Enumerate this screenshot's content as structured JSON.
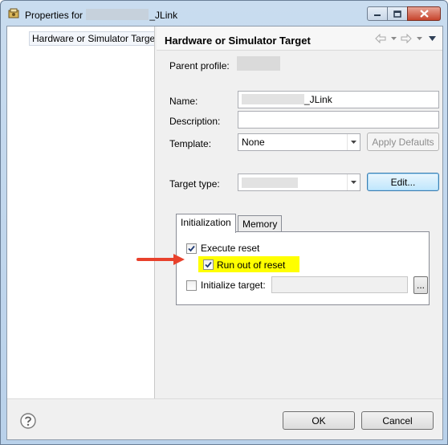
{
  "window": {
    "title_prefix": "Properties for",
    "title_suffix": "_JLink"
  },
  "left_tree": {
    "items": [
      {
        "label": "Hardware or Simulator Target"
      }
    ]
  },
  "page": {
    "title": "Hardware or Simulator Target",
    "parent_profile_label": "Parent profile:",
    "name_label": "Name:",
    "name_value_suffix": "_JLink",
    "description_label": "Description:",
    "description_value": "",
    "template_label": "Template:",
    "template_value": "None",
    "apply_defaults_label": "Apply Defaults",
    "target_type_label": "Target type:",
    "edit_label": "Edit..."
  },
  "tabs": [
    {
      "label": "Initialization",
      "active": true
    },
    {
      "label": "Memory",
      "active": false
    }
  ],
  "initialization": {
    "execute_reset_label": "Execute reset",
    "execute_reset_checked": true,
    "run_out_of_reset_label": "Run out of reset",
    "run_out_of_reset_checked": true,
    "initialize_target_label": "Initialize target:",
    "initialize_target_checked": false,
    "initialize_target_value": "",
    "browse_label": "..."
  },
  "footer": {
    "ok_label": "OK",
    "cancel_label": "Cancel"
  },
  "colors": {
    "highlight": "#ffff00",
    "annotation_arrow": "#e8412c"
  }
}
